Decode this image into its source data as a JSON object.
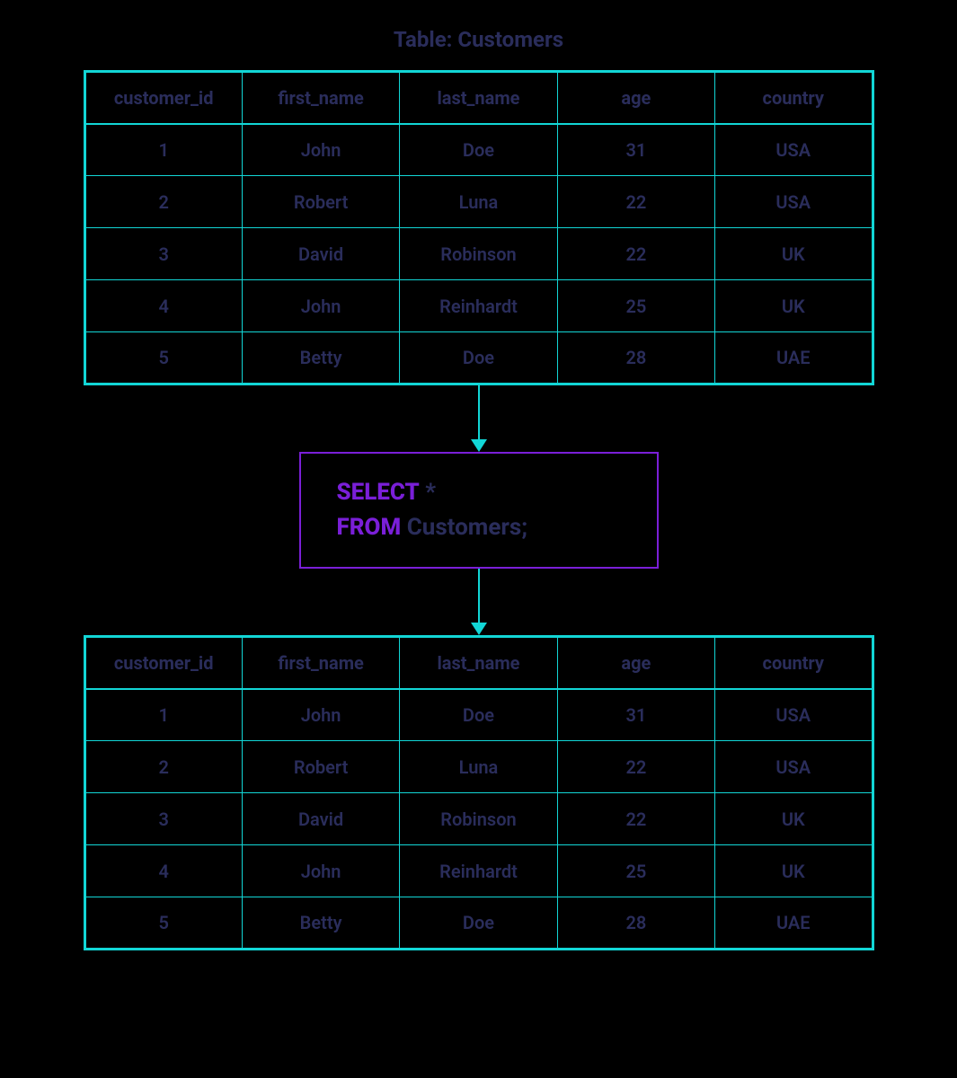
{
  "title": "Table: Customers",
  "source_table": {
    "columns": [
      "customer_id",
      "first_name",
      "last_name",
      "age",
      "country"
    ],
    "rows": [
      [
        "1",
        "John",
        "Doe",
        "31",
        "USA"
      ],
      [
        "2",
        "Robert",
        "Luna",
        "22",
        "USA"
      ],
      [
        "3",
        "David",
        "Robinson",
        "22",
        "UK"
      ],
      [
        "4",
        "John",
        "Reinhardt",
        "25",
        "UK"
      ],
      [
        "5",
        "Betty",
        "Doe",
        "28",
        "UAE"
      ]
    ]
  },
  "query": {
    "kw_select": "SELECT",
    "select_rest": " *",
    "kw_from": "FROM",
    "from_rest": " Customers;"
  },
  "result_table": {
    "columns": [
      "customer_id",
      "first_name",
      "last_name",
      "age",
      "country"
    ],
    "rows": [
      [
        "1",
        "John",
        "Doe",
        "31",
        "USA"
      ],
      [
        "2",
        "Robert",
        "Luna",
        "22",
        "USA"
      ],
      [
        "3",
        "David",
        "Robinson",
        "22",
        "UK"
      ],
      [
        "4",
        "John",
        "Reinhardt",
        "25",
        "UK"
      ],
      [
        "5",
        "Betty",
        "Doe",
        "28",
        "UAE"
      ]
    ]
  },
  "chart_data": {
    "type": "table",
    "title": "Table: Customers",
    "columns": [
      "customer_id",
      "first_name",
      "last_name",
      "age",
      "country"
    ],
    "rows": [
      {
        "customer_id": 1,
        "first_name": "John",
        "last_name": "Doe",
        "age": 31,
        "country": "USA"
      },
      {
        "customer_id": 2,
        "first_name": "Robert",
        "last_name": "Luna",
        "age": 22,
        "country": "USA"
      },
      {
        "customer_id": 3,
        "first_name": "David",
        "last_name": "Robinson",
        "age": 22,
        "country": "UK"
      },
      {
        "customer_id": 4,
        "first_name": "John",
        "last_name": "Reinhardt",
        "age": 25,
        "country": "UK"
      },
      {
        "customer_id": 5,
        "first_name": "Betty",
        "last_name": "Doe",
        "age": 28,
        "country": "UAE"
      }
    ],
    "query": "SELECT * FROM Customers;",
    "result_columns": [
      "customer_id",
      "first_name",
      "last_name",
      "age",
      "country"
    ],
    "result_rows": [
      {
        "customer_id": 1,
        "first_name": "John",
        "last_name": "Doe",
        "age": 31,
        "country": "USA"
      },
      {
        "customer_id": 2,
        "first_name": "Robert",
        "last_name": "Luna",
        "age": 22,
        "country": "USA"
      },
      {
        "customer_id": 3,
        "first_name": "David",
        "last_name": "Robinson",
        "age": 22,
        "country": "UK"
      },
      {
        "customer_id": 4,
        "first_name": "John",
        "last_name": "Reinhardt",
        "age": 25,
        "country": "UK"
      },
      {
        "customer_id": 5,
        "first_name": "Betty",
        "last_name": "Doe",
        "age": 28,
        "country": "UAE"
      }
    ]
  }
}
